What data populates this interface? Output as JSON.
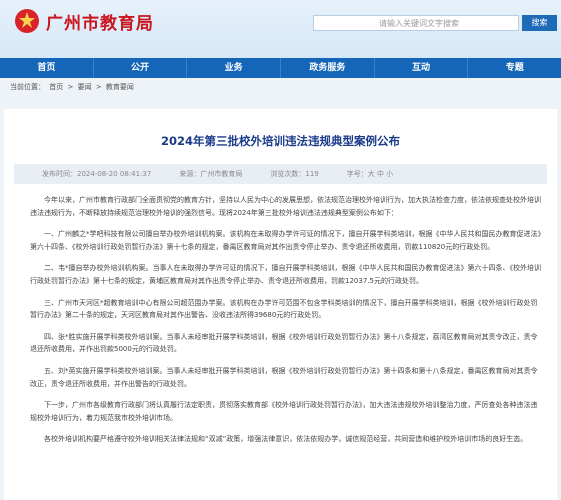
{
  "header": {
    "site_title": "广州市教育局",
    "search_placeholder": "请输入关键词文字搜索",
    "search_button": "搜索"
  },
  "nav": [
    "首页",
    "公开",
    "业务",
    "政务服务",
    "互动",
    "专题"
  ],
  "breadcrumb": [
    "当前位置：",
    "首页",
    ">",
    "要闻",
    ">",
    "教育要闻"
  ],
  "article": {
    "title": "2024年第三批校外培训违法违规典型案例公布",
    "published": "发布时间：2024-08-20 08:41:37",
    "source": "来源：广州市教育局",
    "views": "浏览次数：119",
    "font_size": "字号：大 中 小",
    "paragraphs": [
      "今年以来，广州市教育行政部门全面贯彻党的教育方针，坚持以人民为中心的发展思想，依法规范治理校外培训行为，加大执法检查力度，依法依规查处校外培训违法违规行为，不断释放持续规范治理校外培训的强烈信号。现将2024年第三批校外培训违法违规典型案例公布如下：",
      "一、广州麟之*学吧科技有限公司擅自举办校外培训机构案。该机构在未取得办学许可证的情况下，擅自开展学科类培训，根据《中华人民共和国民办教育促进法》第六十四条、《校外培训行政处罚暂行办法》第十七条的规定，番禺区教育局对其作出责令停止举办、责令退还所收费用，罚款110820元的行政处罚。",
      "二、韦*擅自举办校外培训机构案。当事人在未取得办学许可证的情况下，擅自开展学科类培训，根据《中华人民共和国民办教育促进法》第六十四条、《校外培训行政处罚暂行办法》第十七条的规定，黄埔区教育局对其作出责令停止举办、责令退还所收费用，罚款12037.5元的行政处罚。",
      "三、广州市天河区*超教育培训中心有限公司超范围办学案。该机构在办学许可范围不包含学科类培训的情况下，擅自开展学科类培训，根据《校外培训行政处罚暂行办法》第二十条的规定，天河区教育局对其作出警告、没收违法所得39680元的行政处罚。",
      "四、张*胜实施开展学科类校外培训案。当事人未经审批开展学科类培训，根据《校外培训行政处罚暂行办法》第十八条规定，荔湾区教育局对其责令改正，责令退还所收费用，并作出罚款5000元的行政处罚。",
      "五、刘*英实施开展学科类校外培训案。当事人未经审批开展学科类培训，根据《校外培训行政处罚暂行办法》第十四条和第十八条规定，番禺区教育局对其责令改正，责令退还所收费用，并作出警告的行政处罚。",
      "下一步，广州市各级教育行政部门将认真履行法定职责，贯彻落实教育部《校外培训行政处罚暂行办法》，加大违法违规校外培训整治力度，严厉查处各种违法违规校外培训行为，着力规范我市校外培训市场。",
      "各校外培训机构要严格遵守校外培训相关法律法规和“双减”政策，增强法律意识，依法依规办学，诚信规范经营，共同营造和维护校外培训市场的良好生态。"
    ]
  }
}
